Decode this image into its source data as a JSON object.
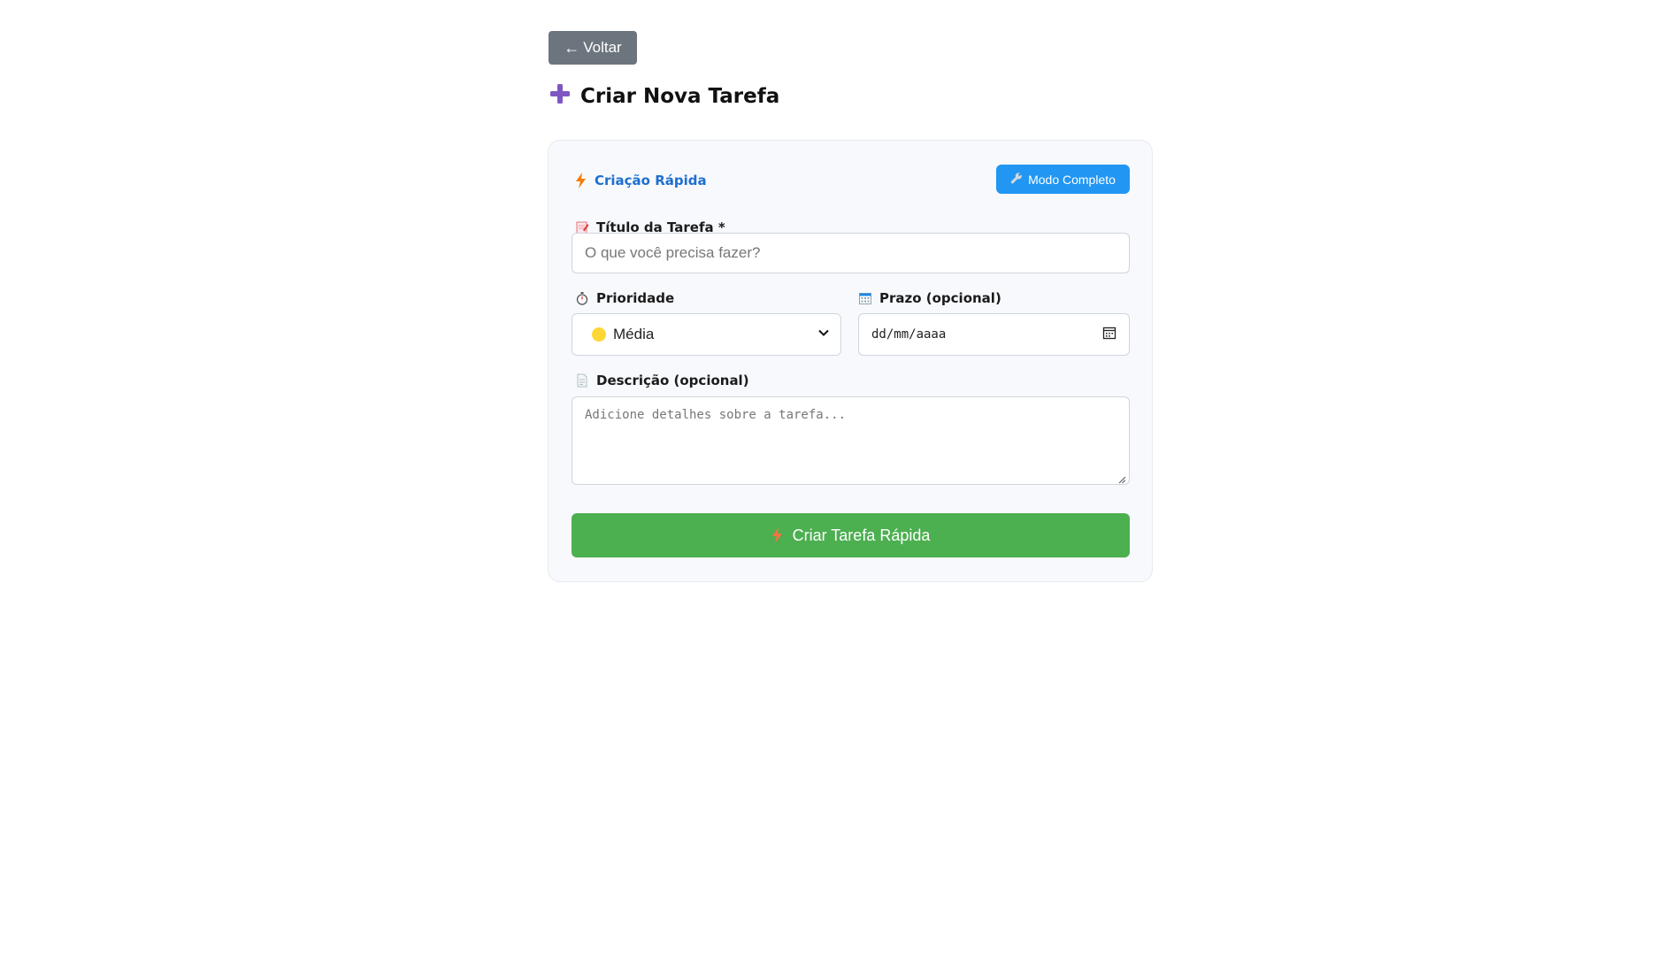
{
  "nav": {
    "back_arrow": "←",
    "back_label": "Voltar"
  },
  "page": {
    "title": "Criar Nova Tarefa",
    "title_icon": "plus-icon",
    "accent_color": "#7e57c2"
  },
  "quick": {
    "label": "Criação Rápida",
    "mode_button_label": "Modo Completo",
    "mode_button_icon": "wrench-icon"
  },
  "form": {
    "title_field": {
      "label": "Título da Tarefa *",
      "icon": "memo-icon",
      "placeholder": "O que você precisa fazer?",
      "value": ""
    },
    "priority_field": {
      "label": "Prioridade",
      "icon": "stopwatch-icon",
      "selected": "Média",
      "selected_indicator": "yellow-circle"
    },
    "deadline_field": {
      "label": "Prazo (opcional)",
      "icon": "calendar-icon",
      "value": "dd/mm/aaaa"
    },
    "description_field": {
      "label": "Descrição (opcional)",
      "icon": "page-icon",
      "placeholder": "Adicione detalhes sobre a tarefa...",
      "value": ""
    }
  },
  "submit": {
    "label": "Criar Tarefa Rápida",
    "icon": "lightning-icon"
  },
  "colors": {
    "back_button": "#6c757d",
    "mode_button": "#2196f3",
    "submit_button": "#4caf50",
    "quick_label": "#1e6fd0",
    "card_bg": "#f7f9fc"
  }
}
